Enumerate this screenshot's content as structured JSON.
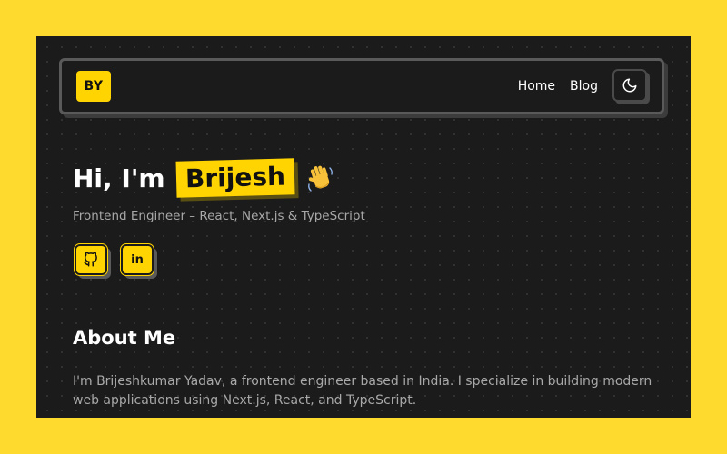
{
  "nav": {
    "logo_text": "BY",
    "links": [
      "Home",
      "Blog"
    ],
    "theme_toggle_icon": "moon-icon"
  },
  "hero": {
    "greeting": "Hi, I'm",
    "name": "Brijesh",
    "emoji_icon": "waving-hand-icon",
    "subtitle": "Frontend Engineer – React, Next.js & TypeScript"
  },
  "socials": [
    {
      "icon": "github-icon"
    },
    {
      "icon": "linkedin-icon",
      "glyph": "in"
    }
  ],
  "about": {
    "heading": "About Me",
    "text": "I'm Brijeshkumar Yadav, a frontend engineer based in India. I specialize in building modern web applications using Next.js, React, and TypeScript."
  },
  "colors": {
    "accent": "#FFD400",
    "page_background": "#FFDA2E",
    "panel_background": "#1b1b1b",
    "muted_text": "#a8a8a8"
  }
}
